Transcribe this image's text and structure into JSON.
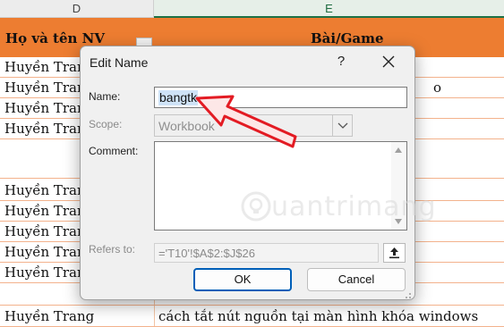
{
  "sheet": {
    "col_d": "D",
    "col_e": "E",
    "header_d": "Họ và tên NV",
    "header_e": "Bài/Game",
    "rows": [
      {
        "d": "Huyền Trang",
        "e": ""
      },
      {
        "d": "Huyền Trang",
        "e": "o"
      },
      {
        "d": "Huyền Trang",
        "e": ""
      },
      {
        "d": "Huyền Trang",
        "e": ""
      },
      {
        "d": "",
        "e": ""
      },
      {
        "d": "Huyền Trang",
        "e": ""
      },
      {
        "d": "Huyền Trang",
        "e": ""
      },
      {
        "d": "Huyền Trang",
        "e": ""
      },
      {
        "d": "Huyền Trang",
        "e": ""
      },
      {
        "d": "Huyền Trang",
        "e": ""
      },
      {
        "d": "",
        "e": ""
      },
      {
        "d": "Huyền Trang",
        "e": "cách tắt nút nguồn tại màn hình khóa windows"
      }
    ]
  },
  "dialog": {
    "title": "Edit Name",
    "help": "?",
    "name_label": "Name:",
    "name_value": "bangtk",
    "scope_label": "Scope:",
    "scope_value": "Workbook",
    "comment_label": "Comment:",
    "refers_label": "Refers to:",
    "refers_value": "='T10'!$A$2:$J$26",
    "ok_label": "OK",
    "cancel_label": "Cancel"
  },
  "watermark": {
    "text": "uantrimang"
  },
  "colors": {
    "header_orange": "#ed7d31",
    "annotation_red": "#e31b23",
    "ok_border": "#005fb8"
  }
}
